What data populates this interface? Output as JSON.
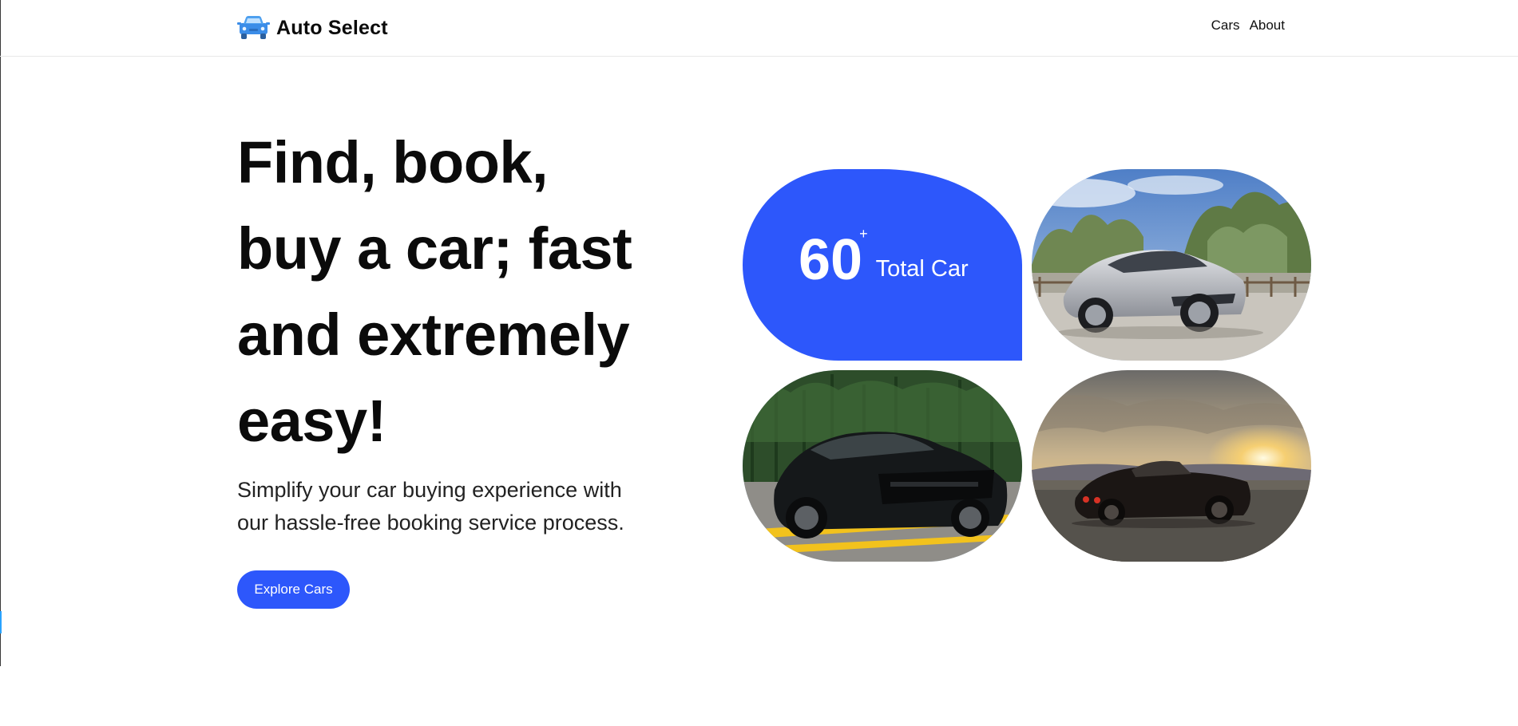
{
  "header": {
    "brand_name": "Auto Select",
    "brand_icon": "car-icon",
    "nav": [
      {
        "label": "Cars"
      },
      {
        "label": "About"
      }
    ]
  },
  "hero": {
    "title_lines": [
      "Find, book,",
      "buy a car; fast",
      "and extremely",
      "easy!"
    ],
    "subtitle_lines": [
      "Simplify your car buying experience with",
      "our hassle-free booking service process."
    ],
    "cta_label": "Explore Cars"
  },
  "stats": {
    "number": "60",
    "suffix": "+",
    "label": "Total Car"
  },
  "colors": {
    "accent": "#2d57fb",
    "text": "#0b0b0b",
    "brand_icon": "#3b8de8"
  },
  "photos": [
    {
      "name": "silver-sedan-photo"
    },
    {
      "name": "black-mustang-photo"
    },
    {
      "name": "classic-muscle-car-sunset-photo"
    }
  ]
}
